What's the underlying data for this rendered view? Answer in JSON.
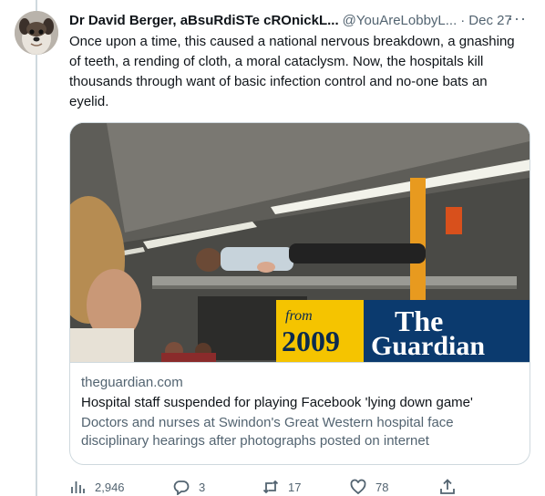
{
  "tweet": {
    "display_name": "Dr David Berger, aBsuRdiSTe cROnickL...",
    "handle": "@YouAreLobbyL...",
    "separator": "·",
    "date": "Dec 27",
    "more_label": "···",
    "text": "Once upon a time, this caused a national nervous breakdown, a gnashing of teeth, a rending of cloth, a moral cataclysm. Now, the hospitals kill thousands through want of basic infection control and no-one bats an eyelid.",
    "avatar_icon": "dog-avatar-icon"
  },
  "card": {
    "image_banner": {
      "from_label": "from",
      "year": "2009",
      "brand_the": "The",
      "brand_name": "Guardian",
      "banner_yellow": "#f5c400",
      "banner_blue": "#0b3a6e"
    },
    "domain": "theguardian.com",
    "title": "Hospital staff suspended for playing Facebook 'lying down game'",
    "description": "Doctors and nurses at Swindon's Great Western hospital face disciplinary hearings after photographs posted on internet"
  },
  "actions": {
    "views": "2,946",
    "replies": "3",
    "retweets": "17",
    "likes": "78"
  },
  "colors": {
    "text_primary": "#0f1419",
    "text_secondary": "#536471",
    "border": "#cfd9de"
  }
}
